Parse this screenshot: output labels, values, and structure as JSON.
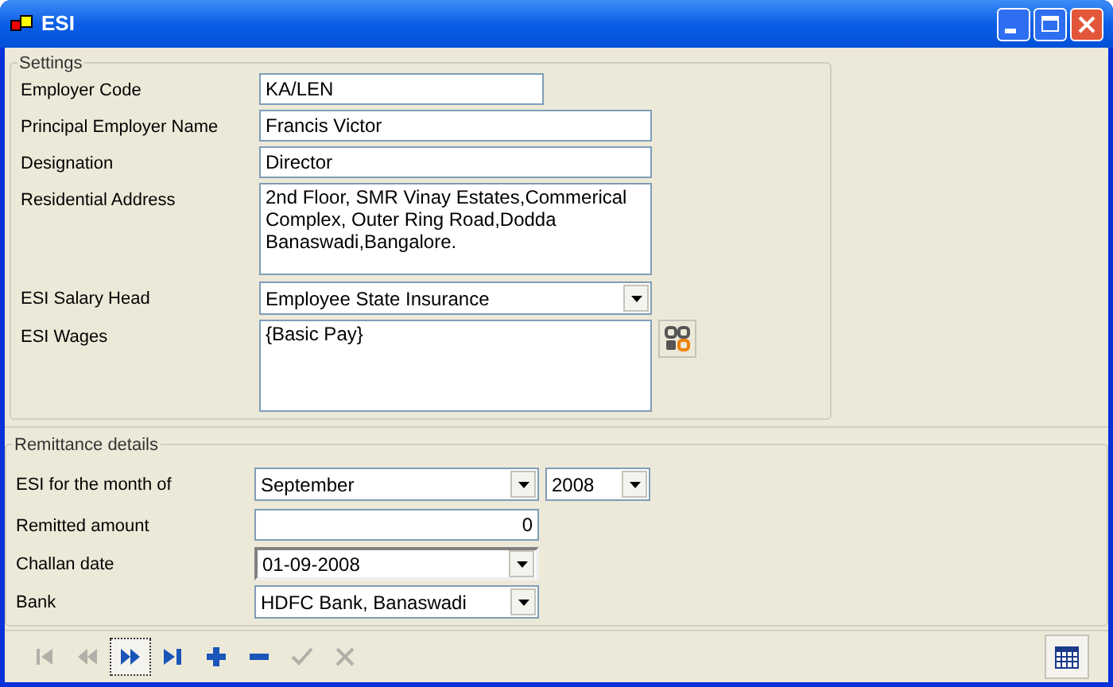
{
  "window": {
    "title": "ESI"
  },
  "settings": {
    "title": "Settings",
    "fields": [
      {
        "label": "Employer Code",
        "controls": [
          {
            "kind": "text",
            "value": "KA/LEN"
          }
        ]
      },
      {
        "label": "Principal Employer Name",
        "controls": [
          {
            "kind": "text",
            "value": "Francis Victor"
          }
        ]
      },
      {
        "label": "Designation",
        "controls": [
          {
            "kind": "text",
            "value": "Director"
          }
        ]
      },
      {
        "label": "Residential Address",
        "controls": [
          {
            "kind": "textarea",
            "value": "2nd Floor, SMR Vinay Estates,Commerical Complex, Outer Ring Road,Dodda Banaswadi,Bangalore."
          }
        ]
      },
      {
        "label": "ESI Salary Head",
        "controls": [
          {
            "kind": "combo",
            "value": "Employee State Insurance"
          }
        ]
      },
      {
        "label": "ESI Wages",
        "controls": [
          {
            "kind": "formula",
            "value": "{Basic Pay}"
          }
        ]
      }
    ]
  },
  "remittance": {
    "title": "Remittance details",
    "fields": [
      {
        "label": "ESI for the month of",
        "controls": [
          {
            "kind": "combo",
            "value": "September"
          },
          {
            "kind": "combo",
            "value": "2008"
          }
        ]
      },
      {
        "label": "Remitted amount",
        "controls": [
          {
            "kind": "number",
            "value": "0"
          }
        ]
      },
      {
        "label": "Challan date",
        "controls": [
          {
            "kind": "date",
            "value": "01-09-2008"
          }
        ]
      },
      {
        "label": "Bank",
        "controls": [
          {
            "kind": "combo",
            "value": "HDFC Bank, Banaswadi"
          }
        ]
      }
    ]
  },
  "toolbar": [
    {
      "kind": "first",
      "disabled": true,
      "selected": false
    },
    {
      "kind": "previous",
      "disabled": true,
      "selected": false
    },
    {
      "kind": "next",
      "disabled": false,
      "selected": true
    },
    {
      "kind": "last",
      "disabled": false,
      "selected": false
    },
    {
      "kind": "add",
      "disabled": false,
      "selected": false
    },
    {
      "kind": "remove",
      "disabled": false,
      "selected": false
    },
    {
      "kind": "save",
      "disabled": true,
      "selected": false
    },
    {
      "kind": "cancel",
      "disabled": true,
      "selected": false
    }
  ]
}
